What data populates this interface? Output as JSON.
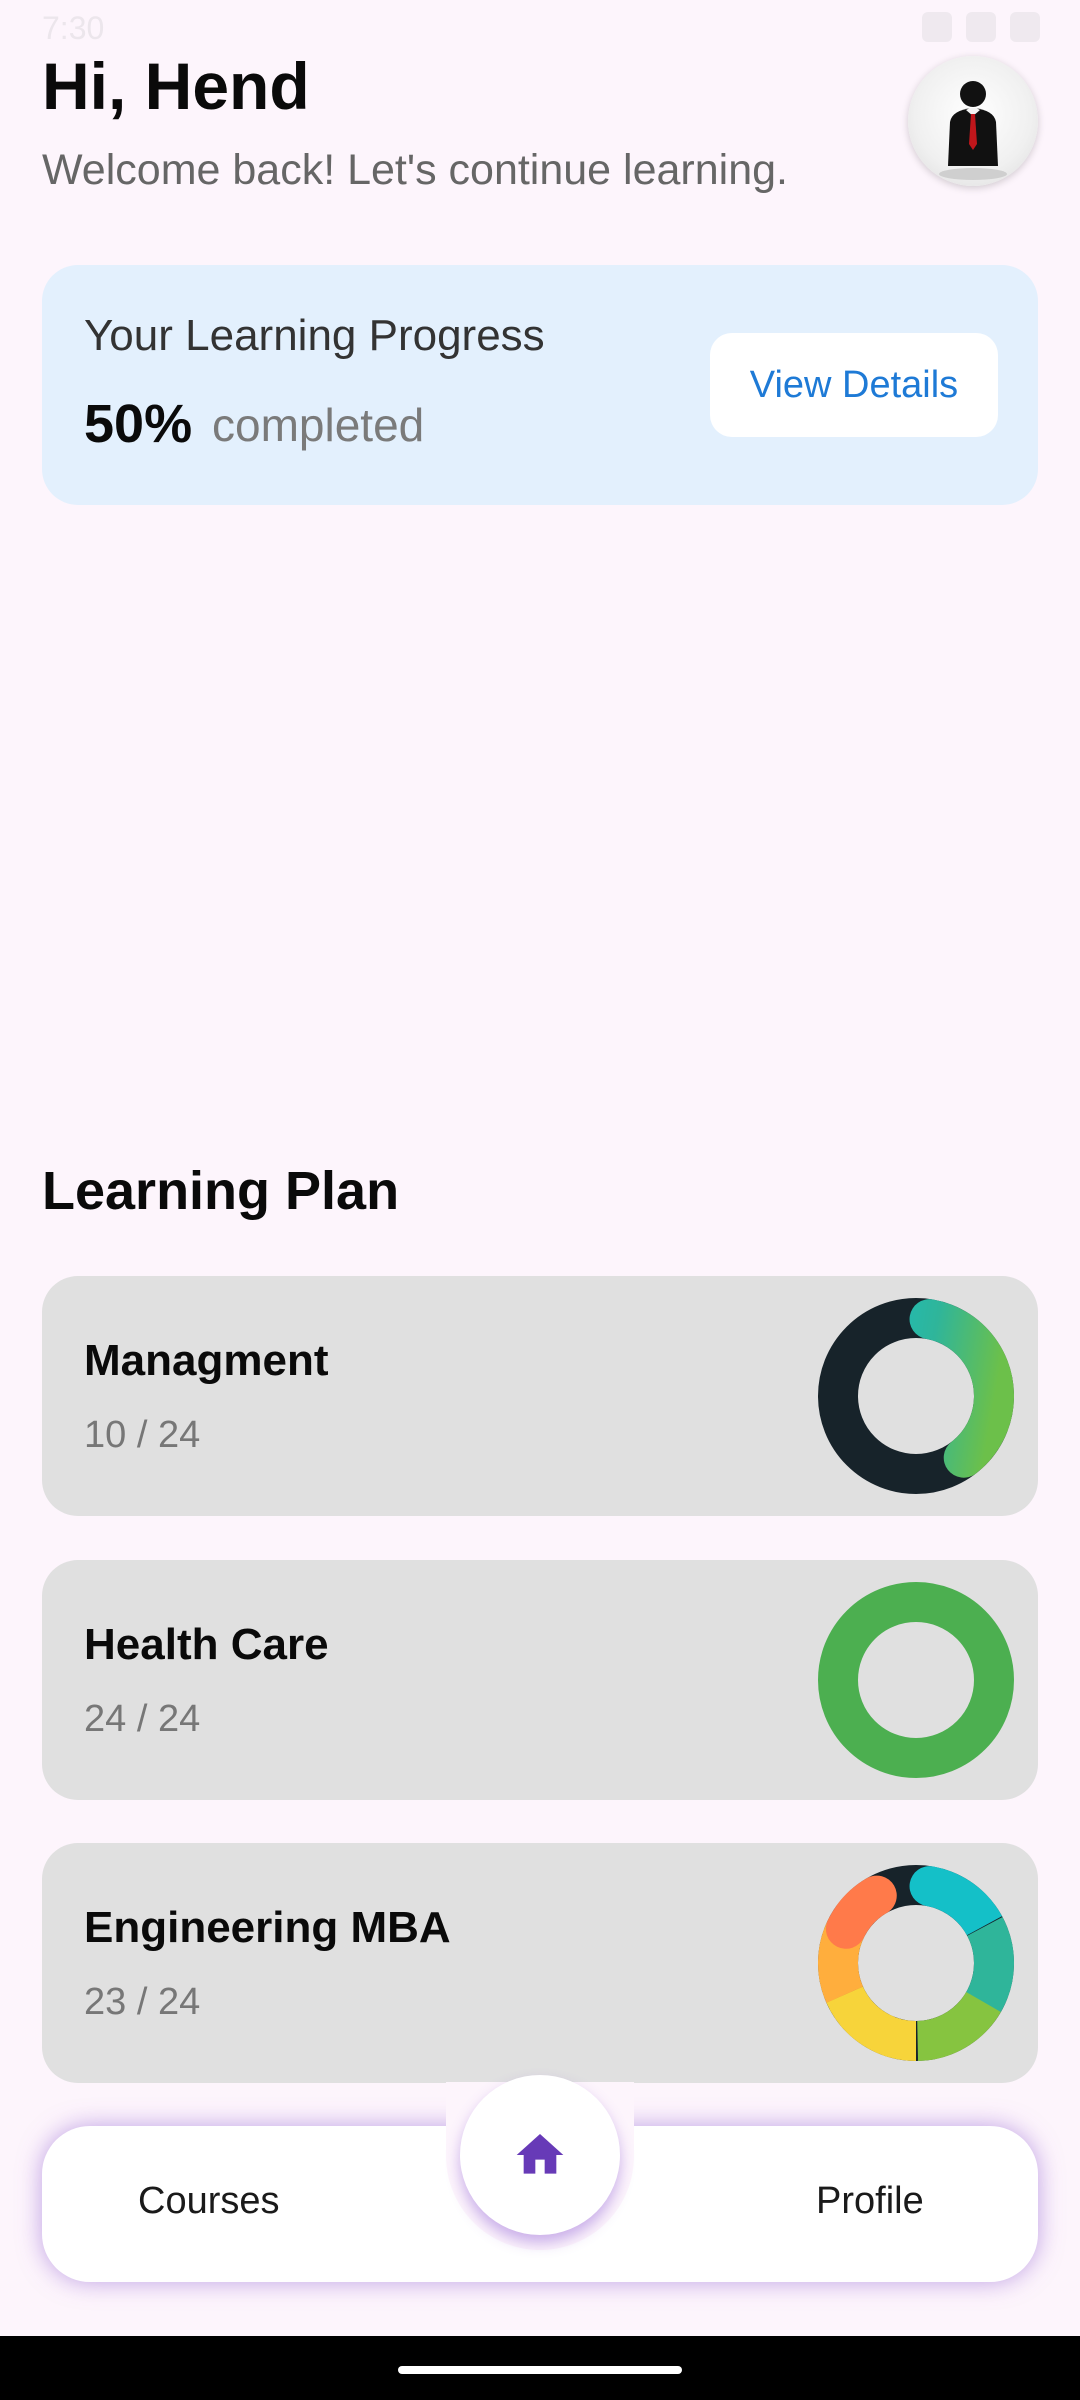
{
  "status_bar": {
    "time": "7:30"
  },
  "header": {
    "greeting": "Hi, Hend",
    "subtitle": "Welcome back! Let's continue learning.",
    "avatar_icon": "user-silhouette-icon"
  },
  "progress_card": {
    "title": "Your Learning Progress",
    "percent_label": "50%",
    "percent_value": 50,
    "suffix": "completed",
    "button_label": "View Details"
  },
  "learning_plan": {
    "title": "Learning Plan",
    "items": [
      {
        "name": "Managment",
        "count": "10 / 24",
        "done": 10,
        "total": 24
      },
      {
        "name": "Health Care",
        "count": "24 / 24",
        "done": 24,
        "total": 24
      },
      {
        "name": "Engineering MBA",
        "count": "23 / 24",
        "done": 23,
        "total": 24
      }
    ]
  },
  "bottom_nav": {
    "left_label": "Courses",
    "right_label": "Profile",
    "center_icon": "home-icon"
  },
  "colors": {
    "background": "#fdf5fc",
    "card_blue": "#e3f0fd",
    "accent_blue": "#1e7ad6",
    "plan_card": "#e0e0e0",
    "ring_track": "#17232a",
    "ring_complete": "#4caf50",
    "nav_accent": "#673ab7"
  }
}
